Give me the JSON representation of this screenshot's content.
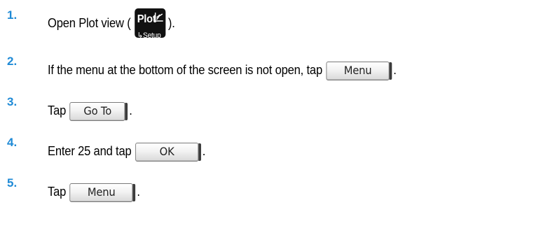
{
  "steps": [
    {
      "number": "1.",
      "prefix": "Open Plot view (",
      "key": {
        "top_label": "Plot",
        "icon": "plot-axes-icon",
        "bottom_label": "↳Setup"
      },
      "suffix": ")."
    },
    {
      "number": "2.",
      "prefix": "If the menu at the bottom of the screen is not open, tap",
      "button": "Menu",
      "suffix": "."
    },
    {
      "number": "3.",
      "prefix": "Tap",
      "button": "Go To",
      "suffix": "."
    },
    {
      "number": "4.",
      "prefix": "Enter 25 and tap",
      "button": "OK",
      "suffix": "."
    },
    {
      "number": "5.",
      "prefix": "Tap",
      "button": "Menu",
      "suffix": "."
    }
  ],
  "colors": {
    "step_number": "#1f8ad6",
    "key_background": "#111111"
  }
}
